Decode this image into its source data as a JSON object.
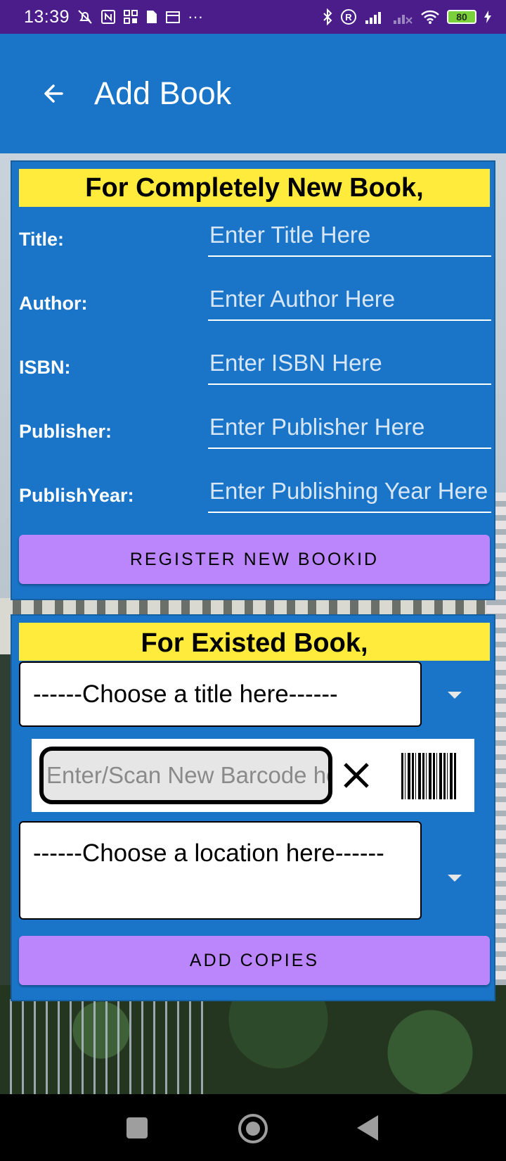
{
  "status_bar": {
    "time": "13:39",
    "left_icons": [
      "muted-notification-icon",
      "nfc-icon",
      "apps-icon",
      "sim-icon",
      "calendar-icon",
      "more-dots-icon"
    ],
    "more_glyph": "···",
    "right_icons": [
      "bluetooth-icon",
      "registered-icon",
      "signal-icon",
      "signal-off-icon",
      "wifi-icon",
      "battery-icon",
      "charging-icon"
    ],
    "battery_level": "80"
  },
  "app_bar": {
    "title": "Add Book"
  },
  "new_book_section": {
    "banner": "For Completely New Book,",
    "fields": [
      {
        "label": "Title:",
        "placeholder": "Enter Title Here"
      },
      {
        "label": "Author:",
        "placeholder": "Enter Author Here"
      },
      {
        "label": "ISBN:",
        "placeholder": "Enter ISBN Here"
      },
      {
        "label": "Publisher:",
        "placeholder": "Enter Publisher Here"
      },
      {
        "label": "PublishYear:",
        "placeholder": "Enter Publishing Year Here"
      }
    ],
    "register_button": "REGISTER NEW BOOKID"
  },
  "existing_book_section": {
    "banner": "For Existed Book,",
    "title_select": "------Choose a title here------",
    "barcode_placeholder": "Enter/Scan New Barcode here",
    "location_select": "------Choose a location here------",
    "add_button": "ADD COPIES"
  },
  "colors": {
    "status_bar": "#4b1d8a",
    "primary": "#1a74c8",
    "banner": "#ffeb3b",
    "button": "#bb86fc"
  }
}
